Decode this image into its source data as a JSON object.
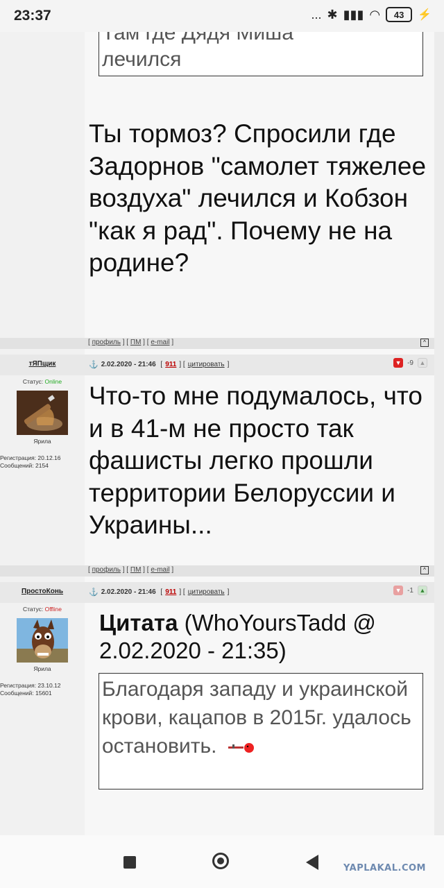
{
  "status_bar": {
    "time": "23:37",
    "signal_text": "...",
    "battery": "43"
  },
  "top_quote": {
    "partial_line": "Там где Дядя Миша",
    "last_line": "лечился"
  },
  "post1": {
    "text": "Ты тормоз? Спросили где Задорнов \"самолет тяжелее воздуха\" лечился и Кобзон \"как я рад\". Почему не на родине?",
    "footer": {
      "profile": "профиль",
      "pm": "ПМ",
      "email": "e-mail",
      "top": "^"
    }
  },
  "post2": {
    "username": "тЯПщик",
    "status_label": "Статус:",
    "status": "Online",
    "rank": "Ярила",
    "reg_label": "Регистрация: 20.12.16",
    "posts_label": "Сообщений: 2154",
    "date": "2.02.2020 - 21:46",
    "post_number": "911",
    "quote_action": "цитировать",
    "rating": "-9",
    "text": "Что-то мне подумалось, что и в 41-м не просто так фашисты легко прошли территории Белоруссии и Украины...",
    "footer": {
      "profile": "профиль",
      "pm": "ПМ",
      "email": "e-mail",
      "top": "^"
    }
  },
  "post3": {
    "username": "ПростоКонь",
    "status_label": "Статус:",
    "status": "Offline",
    "rank": "Ярила",
    "reg_label": "Регистрация: 23.10.12",
    "posts_label": "Сообщений: 15601",
    "date": "2.02.2020 - 21:46",
    "post_number": "911",
    "quote_action": "цитировать",
    "rating": "-1",
    "quote_label": "Цитата",
    "quote_author": "(WhoYoursTadd @ 2.02.2020 - 21:35)",
    "quote_text": "Благодаря западу и украинской крови, кацапов в 2015г. удалось остановить."
  },
  "watermark": "YAPLAKAL.COM",
  "colors": {
    "online": "#22aa22",
    "offline": "#cc2222",
    "rating_down": "#dd2222",
    "watermark": "#6e8ab0"
  }
}
